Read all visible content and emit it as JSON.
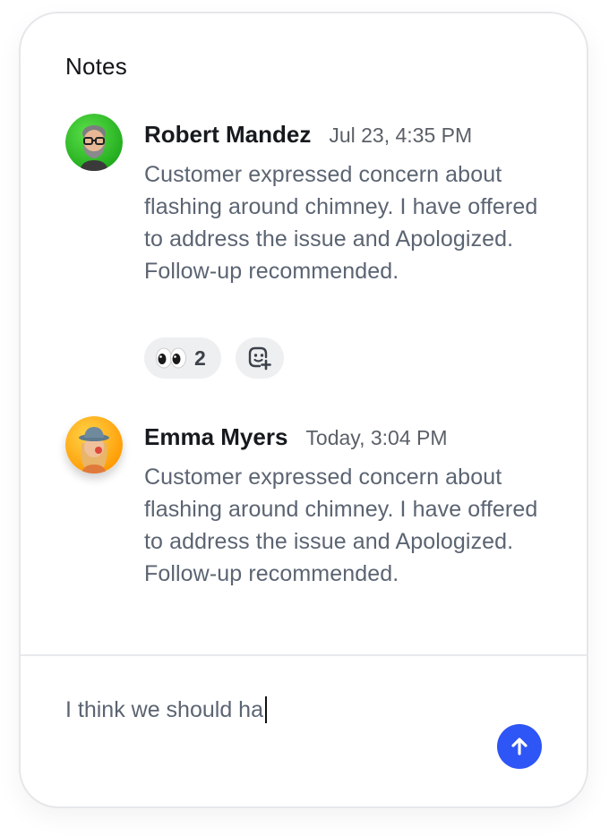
{
  "panel": {
    "title": "Notes"
  },
  "notes": [
    {
      "author": "Robert Mandez",
      "time": "Jul 23, 4:35 PM",
      "text": "Customer expressed concern about flashing around chimney. I have offered to address the issue and Apologized. Follow-up recommended.",
      "avatar_icon": "memoji-man-glasses-icon",
      "avatar_bg": "#2ecc40",
      "reactions": [
        {
          "emoji": "👀",
          "icon": "eyes-emoji-icon",
          "count": "2"
        }
      ],
      "add_reaction_icon": "add-reaction-icon"
    },
    {
      "author": "Emma Myers",
      "time": "Today, 3:04 PM",
      "text": "Customer expressed concern about flashing around chimney. I have offered to address the issue and Apologized. Follow-up recommended.",
      "avatar_icon": "memoji-woman-hat-icon",
      "avatar_bg": "#ffb300"
    }
  ],
  "composer": {
    "value": "I think we should ha",
    "send_icon": "arrow-up-icon",
    "send_color": "#2e55f5"
  }
}
